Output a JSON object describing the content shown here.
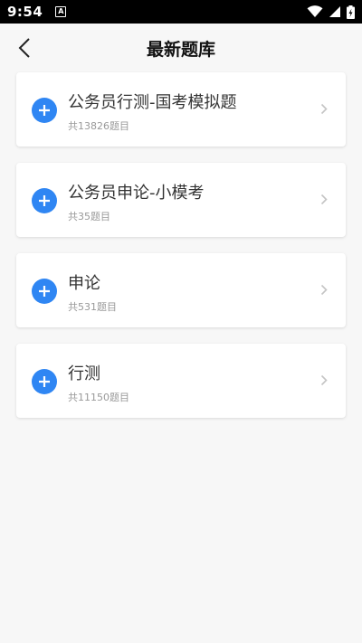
{
  "status_bar": {
    "time": "9:54",
    "notification_glyph": "A"
  },
  "header": {
    "title": "最新题库"
  },
  "banks": [
    {
      "name": "公务员行测-国考模拟题",
      "count": "共13826题目"
    },
    {
      "name": "公务员申论-小模考",
      "count": "共35题目"
    },
    {
      "name": "申论",
      "count": "共531题目"
    },
    {
      "name": "行测",
      "count": "共11150题目"
    }
  ],
  "colors": {
    "accent": "#2f86f3",
    "background": "#f7f7f7"
  }
}
